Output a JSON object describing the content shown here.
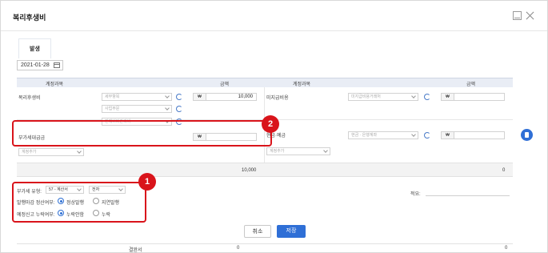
{
  "window": {
    "title": "복리후생비"
  },
  "tab": {
    "label": "발생"
  },
  "date": {
    "value": "2021-01-28"
  },
  "table": {
    "left_headers": {
      "account": "계정과목",
      "amount": "금액"
    },
    "right_headers": {
      "account": "계정과목",
      "amount": "금액"
    }
  },
  "left_rows": {
    "row1": {
      "label": "복리후생비",
      "sel1": "세부항목",
      "sel2": "사업부문",
      "sel3": "판매비와관리비",
      "currency": "₩",
      "amount": "10,000"
    },
    "row2": {
      "label": "부가세대급금",
      "currency": "₩",
      "amount": "",
      "add_account": "계정추가"
    },
    "total": "10,000"
  },
  "right_rows": {
    "row1": {
      "label": "미지급비용",
      "sel1": "미지급비용거래처",
      "currency": "₩",
      "amount": ""
    },
    "row2": {
      "label": "현금·예금",
      "sel1": "현금 · 은행계좌",
      "currency": "₩",
      "amount": "",
      "add_account": "계정추가"
    },
    "total": "0"
  },
  "vat": {
    "type_label": "부가세 유형:",
    "type_value": "57 - 계산서",
    "issue_value": "전자",
    "settle_label": "발행마감 정산여부:",
    "settle_options": [
      "정상발행",
      "지연발행"
    ],
    "settle_selected": 0,
    "omission_label": "예정신고 누락여부:",
    "omission_options": [
      "누락안함",
      "누락"
    ],
    "omission_selected": 0
  },
  "memo": {
    "label": "적요:"
  },
  "annotations": {
    "badge1": "1",
    "badge2": "2"
  },
  "buttons": {
    "cancel": "취소",
    "save": "저장"
  },
  "background": {
    "peek_label": "결완서",
    "peek_left": "0",
    "peek_right": "0"
  },
  "colors": {
    "accent": "#2f6fd6",
    "annotation": "#d9141b",
    "header_bg": "#e9edf5"
  }
}
